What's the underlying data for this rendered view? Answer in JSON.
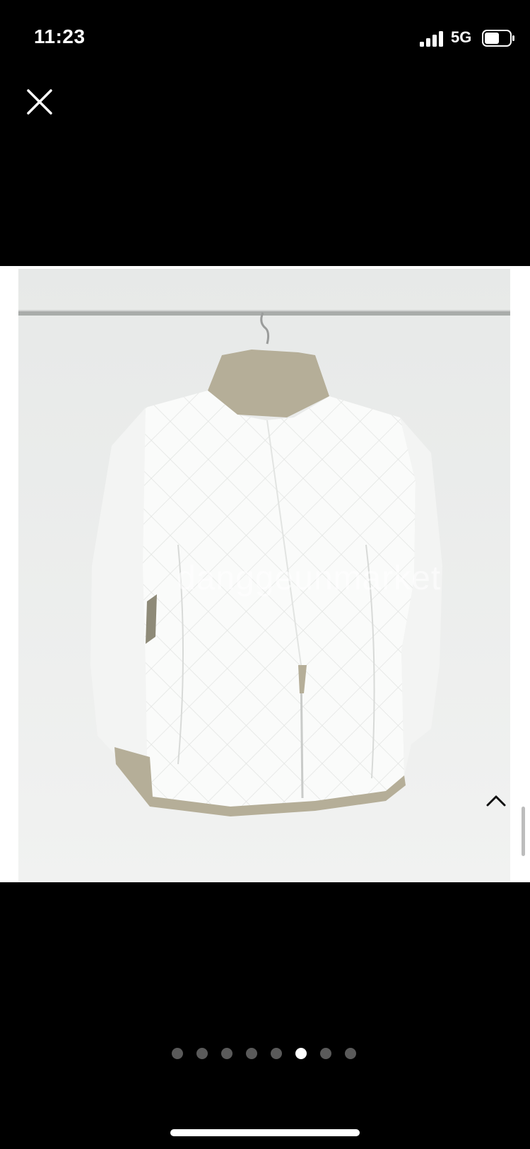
{
  "status_bar": {
    "time": "11:23",
    "network": "5G",
    "signal_icon": "cellular-signal-icon",
    "battery_icon": "battery-icon"
  },
  "viewer": {
    "close_icon": "close-icon",
    "image_description": "product photo",
    "watermark": "danggeunmarket",
    "scroll_up_icon": "chevron-up-icon",
    "page_count": 8,
    "current_page": 6
  },
  "colors": {
    "background": "#000000",
    "photo_background": "#eceeed",
    "dot_inactive": "#5a5a5a",
    "dot_active": "#ffffff"
  }
}
